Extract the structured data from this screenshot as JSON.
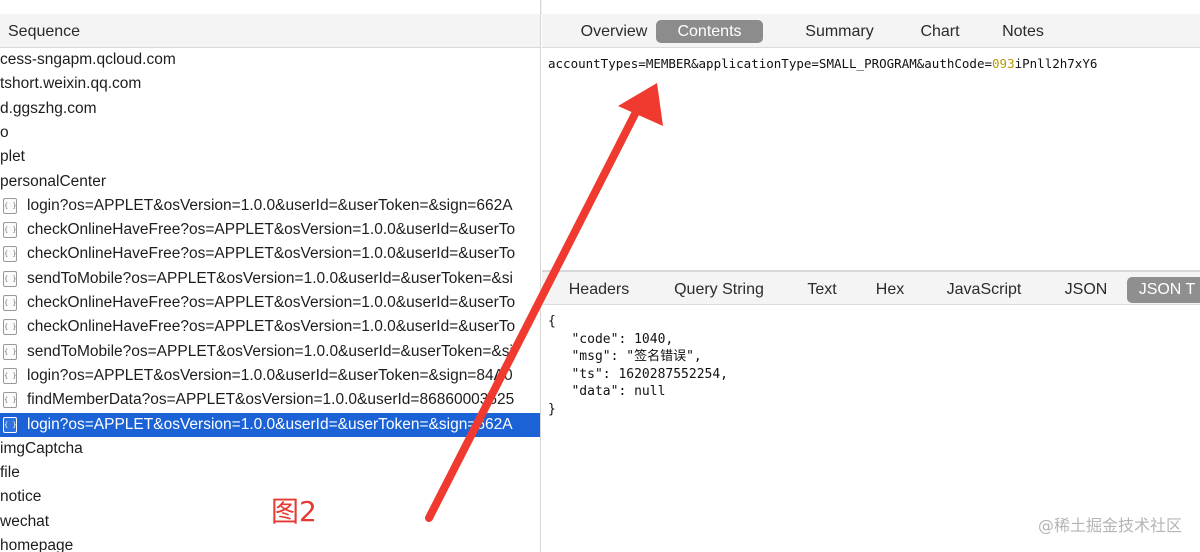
{
  "left_panel": {
    "header": "Sequence",
    "rows": [
      {
        "label": "cess-sngapm.qcloud.com",
        "icon": false,
        "selected": false
      },
      {
        "label": "tshort.weixin.qq.com",
        "icon": false,
        "selected": false
      },
      {
        "label": "d.ggszhg.com",
        "icon": false,
        "selected": false
      },
      {
        "label": "o",
        "icon": false,
        "selected": false
      },
      {
        "label": "plet",
        "icon": false,
        "selected": false
      },
      {
        "label": "personalCenter",
        "icon": false,
        "selected": false
      },
      {
        "label": "login?os=APPLET&osVersion=1.0.0&userId=&userToken=&sign=662A",
        "icon": true,
        "selected": false
      },
      {
        "label": "checkOnlineHaveFree?os=APPLET&osVersion=1.0.0&userId=&userTo",
        "icon": true,
        "selected": false
      },
      {
        "label": "checkOnlineHaveFree?os=APPLET&osVersion=1.0.0&userId=&userTo",
        "icon": true,
        "selected": false
      },
      {
        "label": "sendToMobile?os=APPLET&osVersion=1.0.0&userId=&userToken=&si",
        "icon": true,
        "selected": false
      },
      {
        "label": "checkOnlineHaveFree?os=APPLET&osVersion=1.0.0&userId=&userTo",
        "icon": true,
        "selected": false
      },
      {
        "label": "checkOnlineHaveFree?os=APPLET&osVersion=1.0.0&userId=&userTo",
        "icon": true,
        "selected": false
      },
      {
        "label": "sendToMobile?os=APPLET&osVersion=1.0.0&userId=&userToken=&si",
        "icon": true,
        "selected": false
      },
      {
        "label": "login?os=APPLET&osVersion=1.0.0&userId=&userToken=&sign=84A0",
        "icon": true,
        "selected": false
      },
      {
        "label": "findMemberData?os=APPLET&osVersion=1.0.0&userId=86860003625",
        "icon": true,
        "selected": false
      },
      {
        "label": "login?os=APPLET&osVersion=1.0.0&userId=&userToken=&sign=662A",
        "icon": true,
        "selected": true
      },
      {
        "label": "imgCaptcha",
        "icon": false,
        "selected": false
      },
      {
        "label": "file",
        "icon": false,
        "selected": false
      },
      {
        "label": "notice",
        "icon": false,
        "selected": false
      },
      {
        "label": "wechat",
        "icon": false,
        "selected": false
      },
      {
        "label": "homepage",
        "icon": false,
        "selected": false
      }
    ]
  },
  "top_tabs": [
    {
      "label": "Overview",
      "active": false
    },
    {
      "label": "Contents",
      "active": true
    },
    {
      "label": "Summary",
      "active": false
    },
    {
      "label": "Chart",
      "active": false
    },
    {
      "label": "Notes",
      "active": false
    }
  ],
  "request_body": {
    "prefix": "accountTypes=MEMBER&applicationType=SMALL_PROGRAM&authCode=",
    "highlight": "093",
    "suffix": "iPnll2h7xY6"
  },
  "bottom_tabs": [
    {
      "label": "Headers",
      "active": false
    },
    {
      "label": "Query String",
      "active": false
    },
    {
      "label": "Text",
      "active": false
    },
    {
      "label": "Hex",
      "active": false
    },
    {
      "label": "JavaScript",
      "active": false
    },
    {
      "label": "JSON",
      "active": false
    },
    {
      "label": "JSON T",
      "active": true
    }
  ],
  "response_json": {
    "lines": [
      "{",
      "   \"code\": 1040,",
      "   \"msg\": \"签名错误\",",
      "   \"ts\": 1620287552254,",
      "   \"data\": null",
      "}"
    ]
  },
  "annotation": {
    "figure_label": "图2",
    "arrow_color": "#f03a30"
  },
  "watermark": "@稀土掘金技术社区",
  "icons": {
    "request_row_icon": "json-file-icon"
  }
}
